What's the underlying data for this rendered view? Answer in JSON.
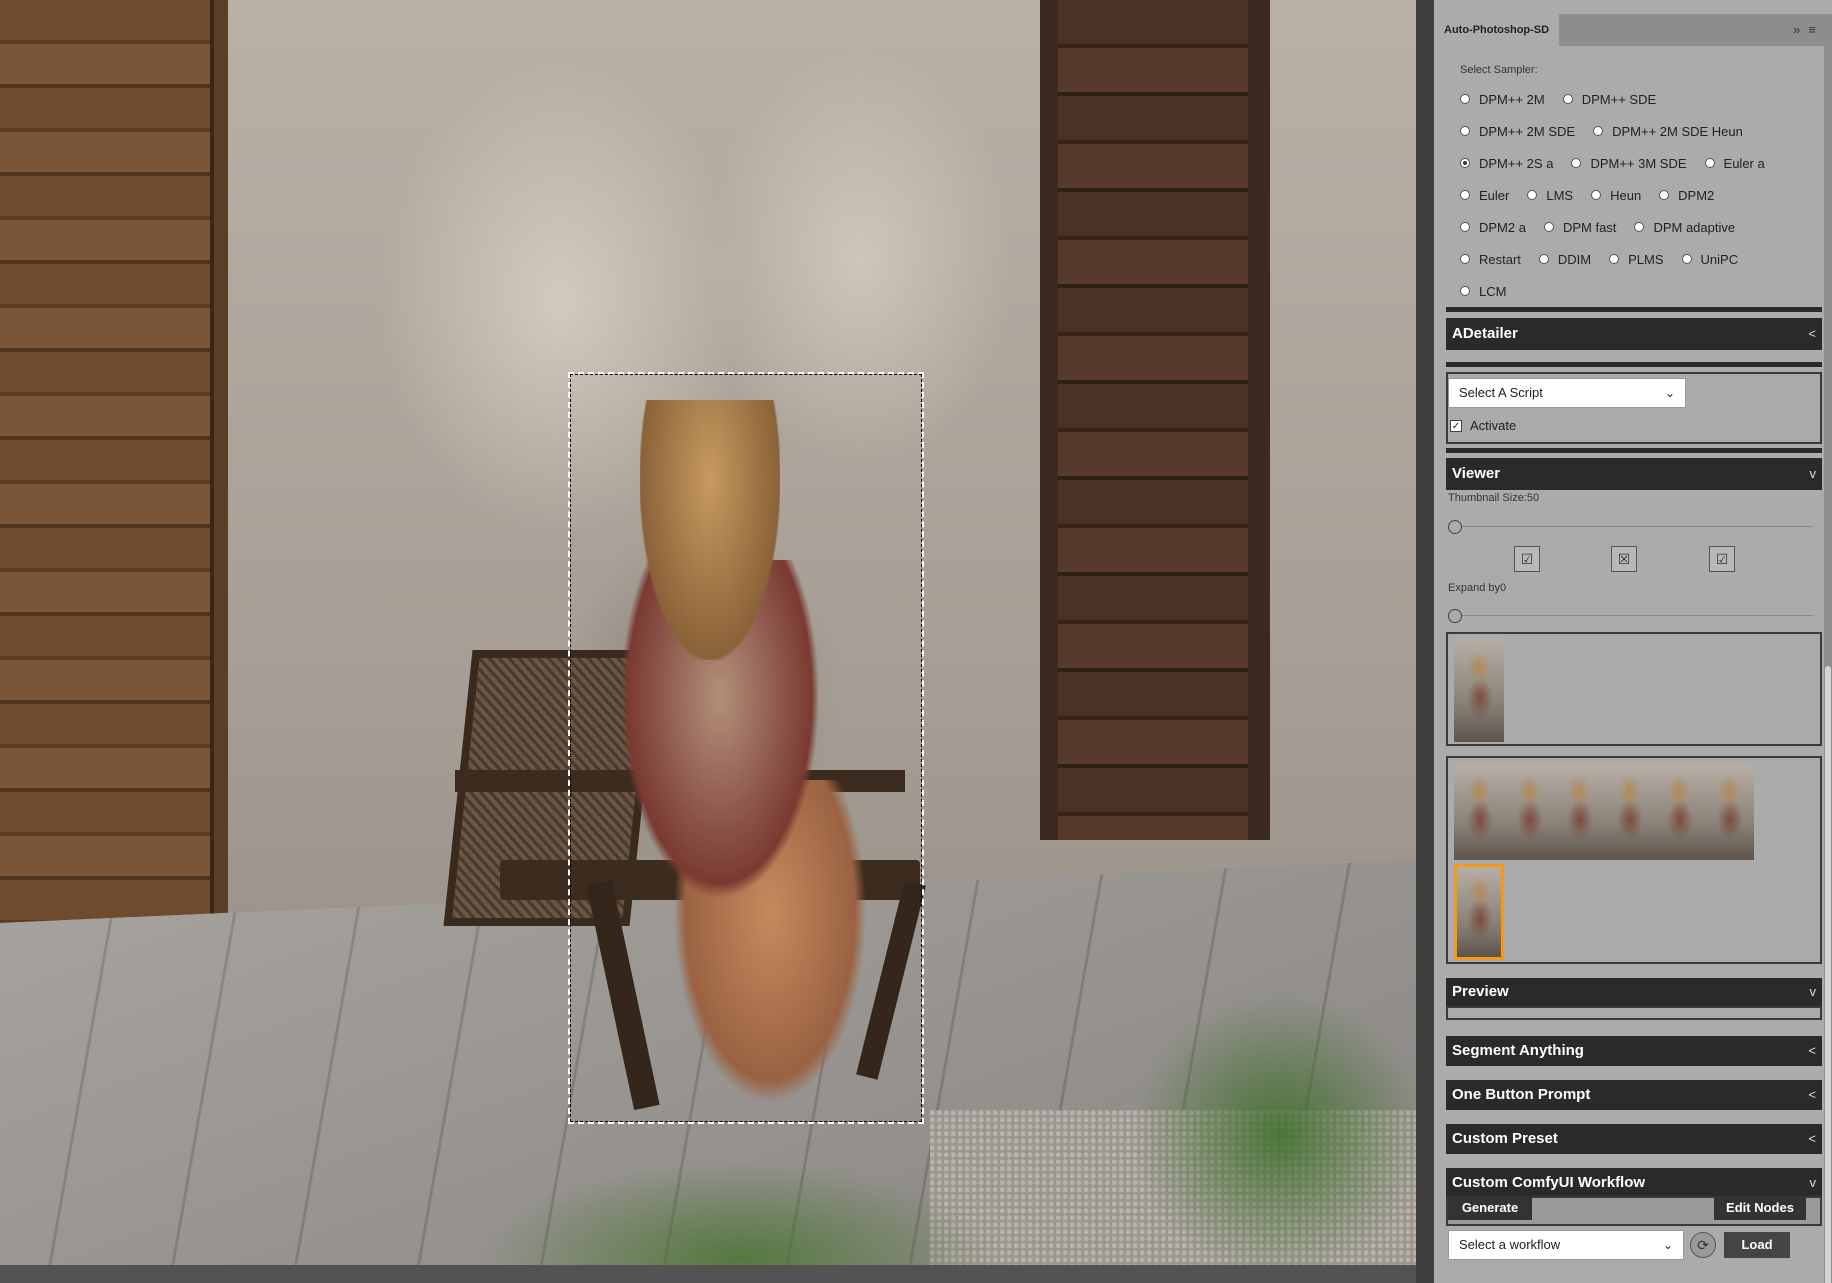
{
  "panel": {
    "tab_title": "Auto-Photoshop-SD",
    "tab_icons": "»≡",
    "sampler": {
      "label": "Select Sampler:",
      "selected": "DPM++ 2S a",
      "rows": [
        [
          "DPM++ 2M",
          "DPM++ SDE"
        ],
        [
          "DPM++ 2M SDE",
          "DPM++ 2M SDE Heun"
        ],
        [
          "DPM++ 2S a",
          "DPM++ 3M SDE",
          "Euler a"
        ],
        [
          "Euler",
          "LMS",
          "Heun",
          "DPM2"
        ],
        [
          "DPM2 a",
          "DPM fast",
          "DPM adaptive"
        ],
        [
          "Restart",
          "DDIM",
          "PLMS",
          "UniPC"
        ],
        [
          "LCM"
        ]
      ]
    },
    "adetailer": {
      "title": "ADetailer",
      "chevron": "<",
      "script_select": "Select A Script",
      "activate_label": "Activate",
      "activate_checked": true
    },
    "viewer": {
      "title": "Viewer",
      "chevron": "v",
      "thumbnail_size_label": "Thumbnail Size:50",
      "expand_by_label": "Expand by0",
      "icon_glyphs": [
        "☑",
        "☒",
        "☑"
      ],
      "thumbs_top_count": 1,
      "thumbs_grid_count": 7,
      "selected_thumb_index": 6
    },
    "preview": {
      "title": "Preview",
      "chevron": "v"
    },
    "segment_anything": {
      "title": "Segment Anything",
      "chevron": "<"
    },
    "one_button_prompt": {
      "title": "One Button Prompt",
      "chevron": "<"
    },
    "custom_preset": {
      "title": "Custom Preset",
      "chevron": "<"
    },
    "comfy": {
      "title": "Custom ComfyUI Workflow",
      "chevron": "v",
      "generate_label": "Generate",
      "edit_nodes_label": "Edit Nodes",
      "workflow_select": "Select a workflow",
      "load_label": "Load"
    }
  },
  "colors": {
    "panel_bg": "#ababab",
    "section_header_bg": "#2a2a2a",
    "selected_thumb_border": "#f29b1a"
  }
}
